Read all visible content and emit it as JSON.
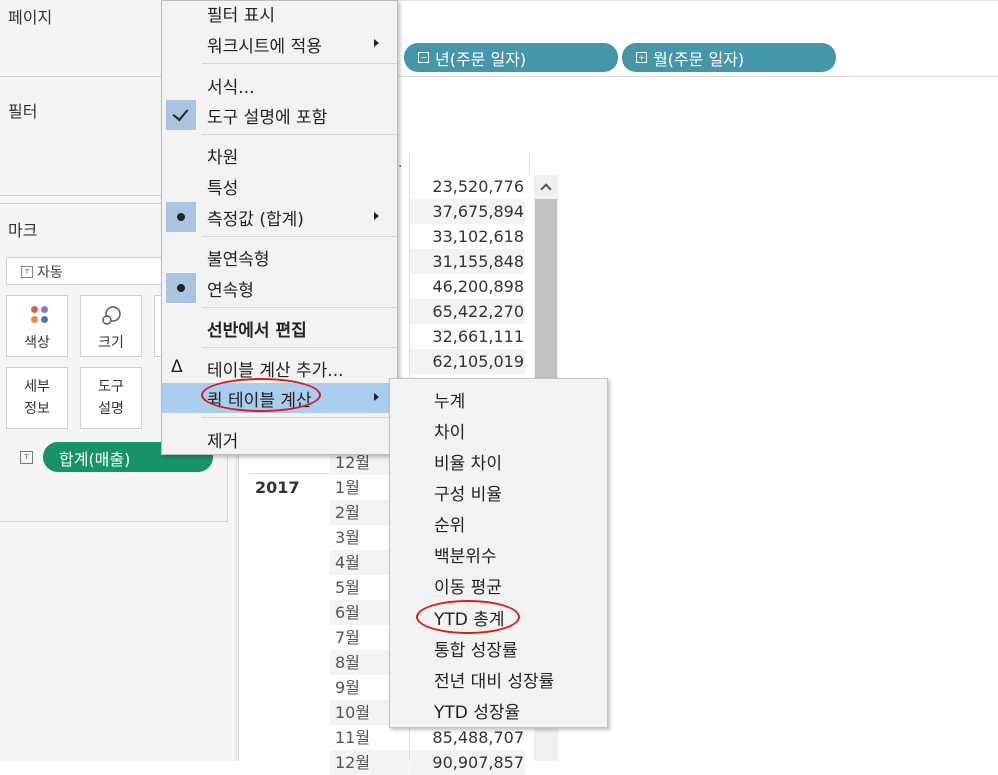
{
  "left_panel": {
    "pages_label": "페이지",
    "filters_label": "필터",
    "marks_label": "마크",
    "marks_type": "자동",
    "mark_buttons": {
      "color": "색상",
      "size": "크기",
      "detail_line1": "세부",
      "detail_line2": "정보",
      "tooltip_line1": "도구",
      "tooltip_line2": "설명"
    },
    "measure_pill": "합계(매출)"
  },
  "columns_shelf": {
    "pills": [
      {
        "label": "년(주문 일자)",
        "symbol": "−"
      },
      {
        "label": "월(주문 일자)",
        "symbol": "+"
      }
    ]
  },
  "table": {
    "header_stub": ".",
    "values": [
      "23,520,776",
      "37,675,894",
      "33,102,618",
      "31,155,848",
      "46,200,898",
      "65,422,270",
      "32,661,111",
      "62,105,019"
    ],
    "bottom_values": [
      "85,488,707",
      "90,907,857"
    ],
    "year": "2017",
    "months_prev": [
      "12월"
    ],
    "months": [
      "1월",
      "2월",
      "3월",
      "4월",
      "5월",
      "6월",
      "7월",
      "8월",
      "9월",
      "10월",
      "11월",
      "12월"
    ]
  },
  "context_menu": {
    "items": {
      "show_filter": "필터 표시",
      "apply_worksheets": "워크시트에 적용",
      "format": "서식...",
      "include_tooltip": "도구 설명에 포함",
      "dimension": "차원",
      "attribute": "특성",
      "measure": "측정값 (합계)",
      "discrete": "불연속형",
      "continuous": "연속형",
      "edit_shelf": "선반에서 편집",
      "add_table_calc": "테이블 계산 추가...",
      "quick_table_calc": "퀵 테이블 계산",
      "remove": "제거"
    }
  },
  "submenu": {
    "items": [
      "누계",
      "차이",
      "비율 차이",
      "구성 비율",
      "순위",
      "백분위수",
      "이동 평균",
      "YTD 총계",
      "통합 성장률",
      "전년 대비 성장률",
      "YTD 성장율"
    ]
  },
  "colors": {
    "menu_highlight": "#a9cdee",
    "pill_blue": "#4596a9",
    "pill_green": "#17936c",
    "annotation_red": "#d81d1d"
  }
}
